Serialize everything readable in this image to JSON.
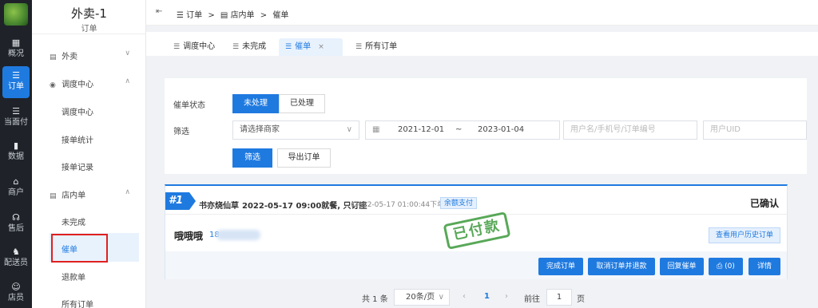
{
  "rail": {
    "items": [
      {
        "icon": "grid-icon",
        "glyph": "▦",
        "label": "概况"
      },
      {
        "icon": "list-icon",
        "glyph": "☰",
        "label": "订单"
      },
      {
        "icon": "list-icon",
        "glyph": "☰",
        "label": "当面付"
      },
      {
        "icon": "bar-chart-icon",
        "glyph": "▮",
        "label": "数据"
      },
      {
        "icon": "shop-icon",
        "glyph": "⌂",
        "label": "商户"
      },
      {
        "icon": "headset-icon",
        "glyph": "☊",
        "label": "售后"
      },
      {
        "icon": "scooter-icon",
        "glyph": "♞",
        "label": "配送员"
      },
      {
        "icon": "user-icon",
        "glyph": "☺",
        "label": "店员"
      }
    ]
  },
  "sidebar": {
    "title": "外卖-1",
    "subtitle": "订单",
    "groups": [
      {
        "label": "外卖",
        "icon": "document-icon"
      },
      {
        "label": "调度中心",
        "icon": "location-icon"
      },
      {
        "label": "店内单",
        "icon": "document-icon"
      }
    ],
    "dispatch_items": [
      "调度中心",
      "接单统计",
      "接单记录"
    ],
    "instore_items": [
      "未完成",
      "催单",
      "退款单",
      "所有订单"
    ]
  },
  "breadcrumb": {
    "items": [
      "订单",
      "店内单",
      "催单"
    ],
    "separator": ">"
  },
  "tabs": [
    {
      "label": "调度中心"
    },
    {
      "label": "未完成"
    },
    {
      "label": "催单",
      "close": "×"
    },
    {
      "label": "所有订单"
    }
  ],
  "filter": {
    "status_label": "催单状态",
    "status_options": [
      "未处理",
      "已处理"
    ],
    "filter_label": "筛选",
    "merchant_placeholder": "请选择商家",
    "date_start": "2021-12-01",
    "date_sep": "~",
    "date_end": "2023-01-04",
    "user_placeholder": "用户名/手机号/订单编号",
    "uid_placeholder": "用户UID",
    "filter_button": "筛选",
    "export_button": "导出订单"
  },
  "order": {
    "number": "#1",
    "shop": "书亦烧仙草",
    "time": "2022-05-17 09:00就餐, 只订座",
    "paid_at": "(2022-05-17 01:00:44下单)",
    "pay_method": "余额支付",
    "status": "已确认",
    "customer": "哦哦哦",
    "phone_prefix": "18",
    "stamp": "已付款",
    "history_button": "查看用户历史订单",
    "actions": [
      "完成订单",
      "取消订单并退款",
      "回复催单",
      "⎙ (0)",
      "详情"
    ]
  },
  "pagination": {
    "total": "共 1 条",
    "page_size": "20条/页",
    "prev": "‹",
    "current": "1",
    "next": "›",
    "goto_label": "前往",
    "goto_value": "1",
    "goto_suffix": "页"
  },
  "colors": {
    "accent": "#1f7ae0",
    "rail": "#1f2329",
    "highlight_box": "#e02020",
    "stamp": "#3c9a3c"
  }
}
